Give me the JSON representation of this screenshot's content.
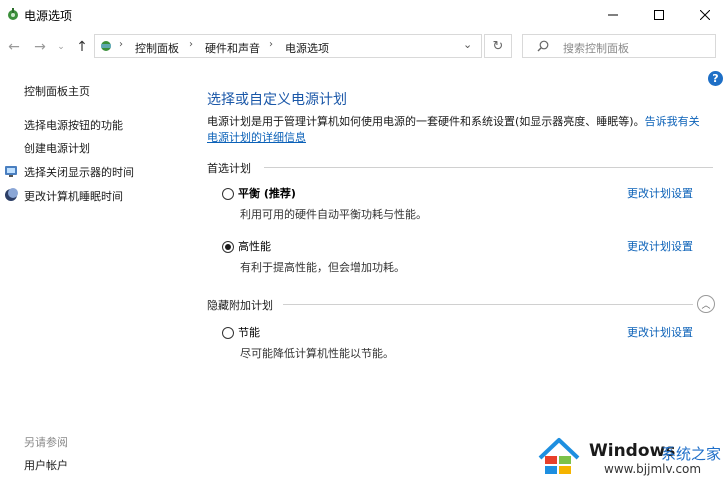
{
  "window": {
    "title": "电源选项"
  },
  "address": {
    "crumbs": [
      "控制面板",
      "硬件和声音",
      "电源选项"
    ],
    "search_placeholder": "搜索控制面板"
  },
  "left": {
    "home": "控制面板主页",
    "links": [
      "选择电源按钮的功能",
      "创建电源计划",
      "选择关闭显示器的时间",
      "更改计算机睡眠时间"
    ],
    "see_also": "另请参阅",
    "see_also_links": [
      "用户帐户"
    ]
  },
  "main": {
    "title": "选择或自定义电源计划",
    "desc_text": "电源计划是用于管理计算机如何使用电源的一套硬件和系统设置(如显示器亮度、睡眠等)。",
    "desc_link_a": "告诉我有关",
    "desc_link_b": "电源计划的详细信息",
    "preferred_header": "首选计划",
    "hidden_header": "隐藏附加计划",
    "change_label": "更改计划设置",
    "plans": [
      {
        "name": "平衡 (推荐)",
        "desc": "利用可用的硬件自动平衡功耗与性能。",
        "selected": false
      },
      {
        "name": "高性能",
        "desc": "有利于提高性能，但会增加功耗。",
        "selected": true
      },
      {
        "name": "节能",
        "desc": "尽可能降低计算机性能以节能。",
        "selected": false
      }
    ]
  },
  "watermark": {
    "brand": "Windows",
    "cn": "系统之家",
    "url": "www.bjjmlv.com"
  },
  "colors": {
    "link": "#0b61b8",
    "title": "#1a57a8",
    "help": "#1e6fc6"
  }
}
